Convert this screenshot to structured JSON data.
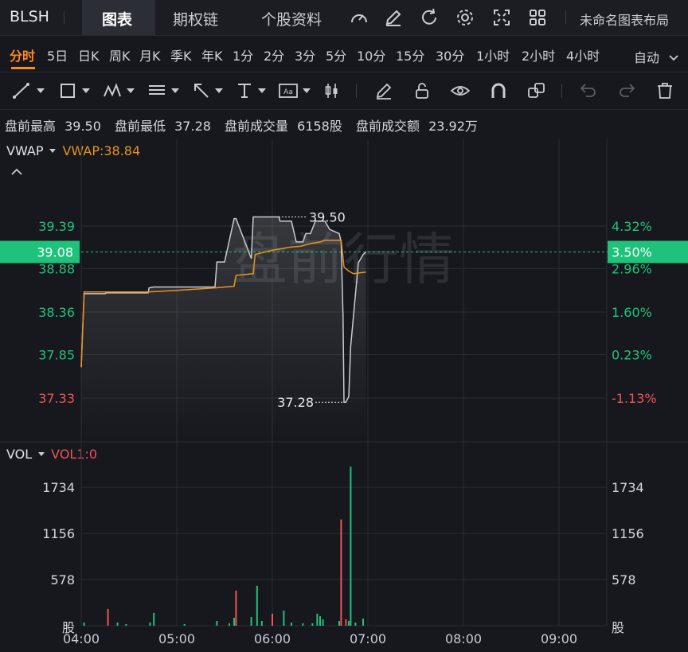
{
  "header": {
    "ticker": "BLSH",
    "tabs": [
      {
        "label": "图表",
        "active": true
      },
      {
        "label": "期权链",
        "active": false
      },
      {
        "label": "个股资料",
        "active": false
      }
    ],
    "icons": [
      "gauge-icon",
      "edit-icon",
      "refresh-icon",
      "gear-icon",
      "fullscreen-icon",
      "grid-icon"
    ],
    "layout_label": "未命名图表布局"
  },
  "periods": {
    "items": [
      "分时",
      "5日",
      "日K",
      "周K",
      "月K",
      "季K",
      "年K",
      "1分",
      "2分",
      "3分",
      "5分",
      "10分",
      "15分",
      "30分",
      "1小时",
      "2小时",
      "4小时"
    ],
    "active": "分时",
    "mode_label": "自动"
  },
  "toolbar": {
    "icons": [
      "trendline-icon",
      "rectangle-icon",
      "pattern-icon",
      "fib-icon",
      "arrow-icon",
      "text-icon",
      "note-icon",
      "candle-icon",
      "pencil-icon",
      "unlock-icon",
      "eye-icon",
      "magnet-icon",
      "clone-icon",
      "undo-icon",
      "redo-icon",
      "trash-icon"
    ]
  },
  "stats": [
    {
      "label": "盘前最高",
      "value": "39.50"
    },
    {
      "label": "盘前最低",
      "value": "37.28"
    },
    {
      "label": "盘前成交量",
      "value": "6158股"
    },
    {
      "label": "盘前成交额",
      "value": "23.92万"
    }
  ],
  "colors": {
    "background": "#16181d",
    "grid": "#2a2d33",
    "price_line": "#c8cbd2",
    "vwap_line": "#e8941d",
    "up": "#22c17c",
    "down": "#f05454",
    "current_badge": "#1fc27a",
    "watermark": "#3a3d43"
  },
  "chart_data": [
    {
      "type": "line",
      "indicator": "VWAP",
      "indicator_label": "VWAP:38.84",
      "watermark": "盘前行情",
      "x_ticks": [
        "04:00",
        "05:00",
        "06:00",
        "07:00",
        "08:00",
        "09:00"
      ],
      "x_range_hours": [
        4.0,
        9.5
      ],
      "ylim": [
        37.1,
        39.95
      ],
      "prev_close": 37.75,
      "y_ticks_left": [
        {
          "value": 39.39,
          "label": "39.39"
        },
        {
          "value": 38.88,
          "label": "38.88"
        },
        {
          "value": 38.36,
          "label": "38.36"
        },
        {
          "value": 37.85,
          "label": "37.85"
        },
        {
          "value": 37.33,
          "label": "37.33"
        }
      ],
      "y_ticks_right": [
        {
          "value": 39.39,
          "label": "4.32%"
        },
        {
          "value": 38.88,
          "label": "2.96%"
        },
        {
          "value": 38.36,
          "label": "1.60%"
        },
        {
          "value": 37.85,
          "label": "0.23%"
        },
        {
          "value": 37.33,
          "label": "-1.13%"
        }
      ],
      "current": {
        "value": 39.08,
        "label": "39.08",
        "pct_label": "3.50%"
      },
      "annotations": [
        {
          "label": "39.50",
          "x": 6.05,
          "y": 39.5,
          "side": "right"
        },
        {
          "label": "37.28",
          "x": 6.75,
          "y": 37.28,
          "side": "left"
        }
      ],
      "series": [
        {
          "role": "price",
          "x": [
            4.0,
            4.03,
            4.25,
            4.26,
            4.7,
            4.71,
            4.76,
            5.0,
            5.4,
            5.42,
            5.5,
            5.6,
            5.62,
            5.78,
            5.8,
            5.9,
            6.07,
            6.08,
            6.2,
            6.25,
            6.32,
            6.35,
            6.4,
            6.45,
            6.55,
            6.6,
            6.7,
            6.72,
            6.74,
            6.75,
            6.77,
            6.8,
            6.82,
            6.9,
            6.95,
            6.98
          ],
          "y": [
            37.7,
            38.58,
            38.58,
            38.59,
            38.59,
            38.65,
            38.66,
            38.66,
            38.66,
            38.96,
            38.96,
            39.48,
            39.48,
            39.0,
            39.5,
            39.5,
            39.5,
            39.45,
            39.45,
            39.2,
            39.2,
            39.3,
            39.3,
            39.45,
            39.45,
            39.35,
            39.3,
            39.2,
            38.3,
            37.28,
            37.28,
            37.35,
            37.95,
            38.95,
            39.05,
            39.08
          ]
        },
        {
          "role": "vwap",
          "x": [
            4.0,
            4.03,
            4.25,
            4.7,
            5.0,
            5.4,
            5.6,
            5.62,
            5.8,
            5.82,
            6.0,
            6.1,
            6.2,
            6.3,
            6.4,
            6.5,
            6.55,
            6.72,
            6.75,
            6.8,
            6.85,
            6.98
          ],
          "y": [
            37.7,
            38.6,
            38.6,
            38.6,
            38.62,
            38.65,
            38.67,
            38.8,
            38.82,
            39.05,
            39.1,
            39.12,
            39.14,
            39.15,
            39.18,
            39.2,
            39.22,
            39.22,
            38.9,
            38.85,
            38.82,
            38.84
          ]
        }
      ]
    },
    {
      "type": "bar",
      "indicator": "VOL",
      "indicator_label": "VOL1:0",
      "unit_label": "股",
      "x_range_hours": [
        4.0,
        9.5
      ],
      "ylim": [
        0,
        2000
      ],
      "y_ticks": [
        1734,
        1156,
        578
      ],
      "bars": [
        {
          "x": 4.03,
          "v": 40,
          "dir": "up"
        },
        {
          "x": 4.28,
          "v": 210,
          "dir": "down"
        },
        {
          "x": 4.38,
          "v": 40,
          "dir": "up"
        },
        {
          "x": 4.47,
          "v": 20,
          "dir": "up"
        },
        {
          "x": 4.72,
          "v": 40,
          "dir": "up"
        },
        {
          "x": 4.76,
          "v": 160,
          "dir": "up"
        },
        {
          "x": 5.08,
          "v": 20,
          "dir": "up"
        },
        {
          "x": 5.42,
          "v": 60,
          "dir": "up"
        },
        {
          "x": 5.55,
          "v": 30,
          "dir": "up"
        },
        {
          "x": 5.6,
          "v": 100,
          "dir": "up"
        },
        {
          "x": 5.62,
          "v": 440,
          "dir": "down"
        },
        {
          "x": 5.78,
          "v": 110,
          "dir": "up"
        },
        {
          "x": 5.84,
          "v": 500,
          "dir": "up"
        },
        {
          "x": 5.89,
          "v": 60,
          "dir": "up"
        },
        {
          "x": 6.0,
          "v": 150,
          "dir": "down"
        },
        {
          "x": 6.12,
          "v": 190,
          "dir": "up"
        },
        {
          "x": 6.2,
          "v": 40,
          "dir": "up"
        },
        {
          "x": 6.32,
          "v": 30,
          "dir": "up"
        },
        {
          "x": 6.42,
          "v": 30,
          "dir": "up"
        },
        {
          "x": 6.47,
          "v": 150,
          "dir": "up"
        },
        {
          "x": 6.5,
          "v": 120,
          "dir": "up"
        },
        {
          "x": 6.53,
          "v": 80,
          "dir": "up"
        },
        {
          "x": 6.7,
          "v": 60,
          "dir": "up"
        },
        {
          "x": 6.72,
          "v": 1330,
          "dir": "down"
        },
        {
          "x": 6.77,
          "v": 80,
          "dir": "down"
        },
        {
          "x": 6.8,
          "v": 60,
          "dir": "up"
        },
        {
          "x": 6.82,
          "v": 1990,
          "dir": "up"
        },
        {
          "x": 6.87,
          "v": 40,
          "dir": "up"
        },
        {
          "x": 6.95,
          "v": 90,
          "dir": "up"
        }
      ]
    }
  ]
}
